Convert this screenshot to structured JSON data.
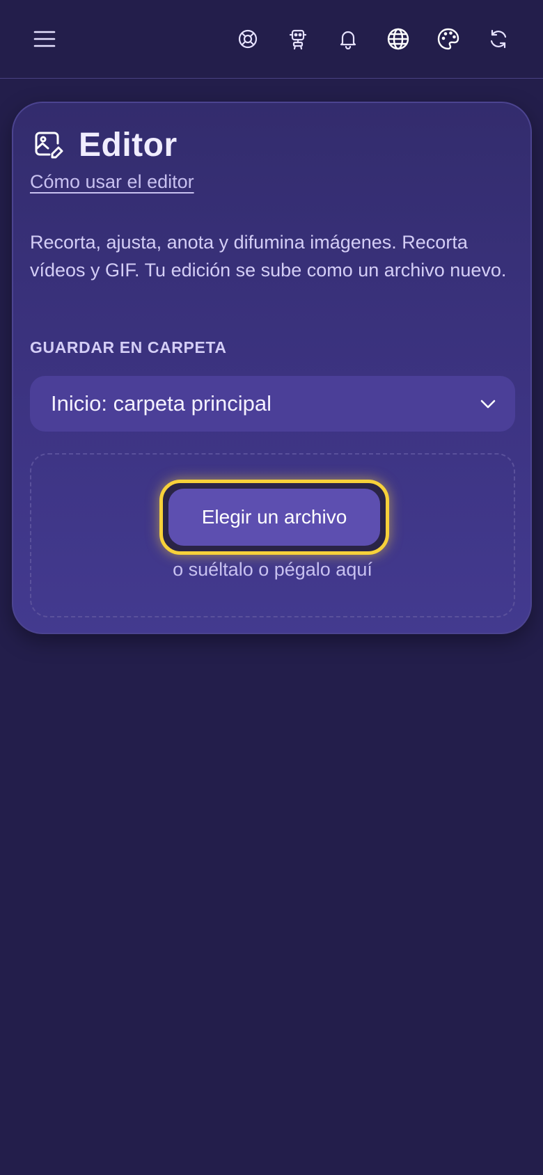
{
  "topbar": {
    "icons": [
      "menu-icon",
      "help-lifebuoy-icon",
      "robot-icon",
      "bell-icon",
      "globe-icon",
      "palette-icon",
      "refresh-icon"
    ]
  },
  "card": {
    "icon": "image-edit-icon",
    "title": "Editor",
    "howto_link": "Cómo usar el editor",
    "description": "Recorta, ajusta, anota y difumina imágenes. Recorta vídeos y GIF. Tu edición se sube como un archivo nuevo.",
    "folder_label": "GUARDAR EN CARPETA",
    "folder_value": "Inicio: carpeta principal",
    "choose_button": "Elegir un archivo",
    "drop_hint": "o suéltalo o pégalo aquí"
  },
  "colors": {
    "background": "#231e4b",
    "card": "#3d3483",
    "select": "#4b3f98",
    "button": "#5d4fb0",
    "focus_ring": "#f7d13a"
  }
}
